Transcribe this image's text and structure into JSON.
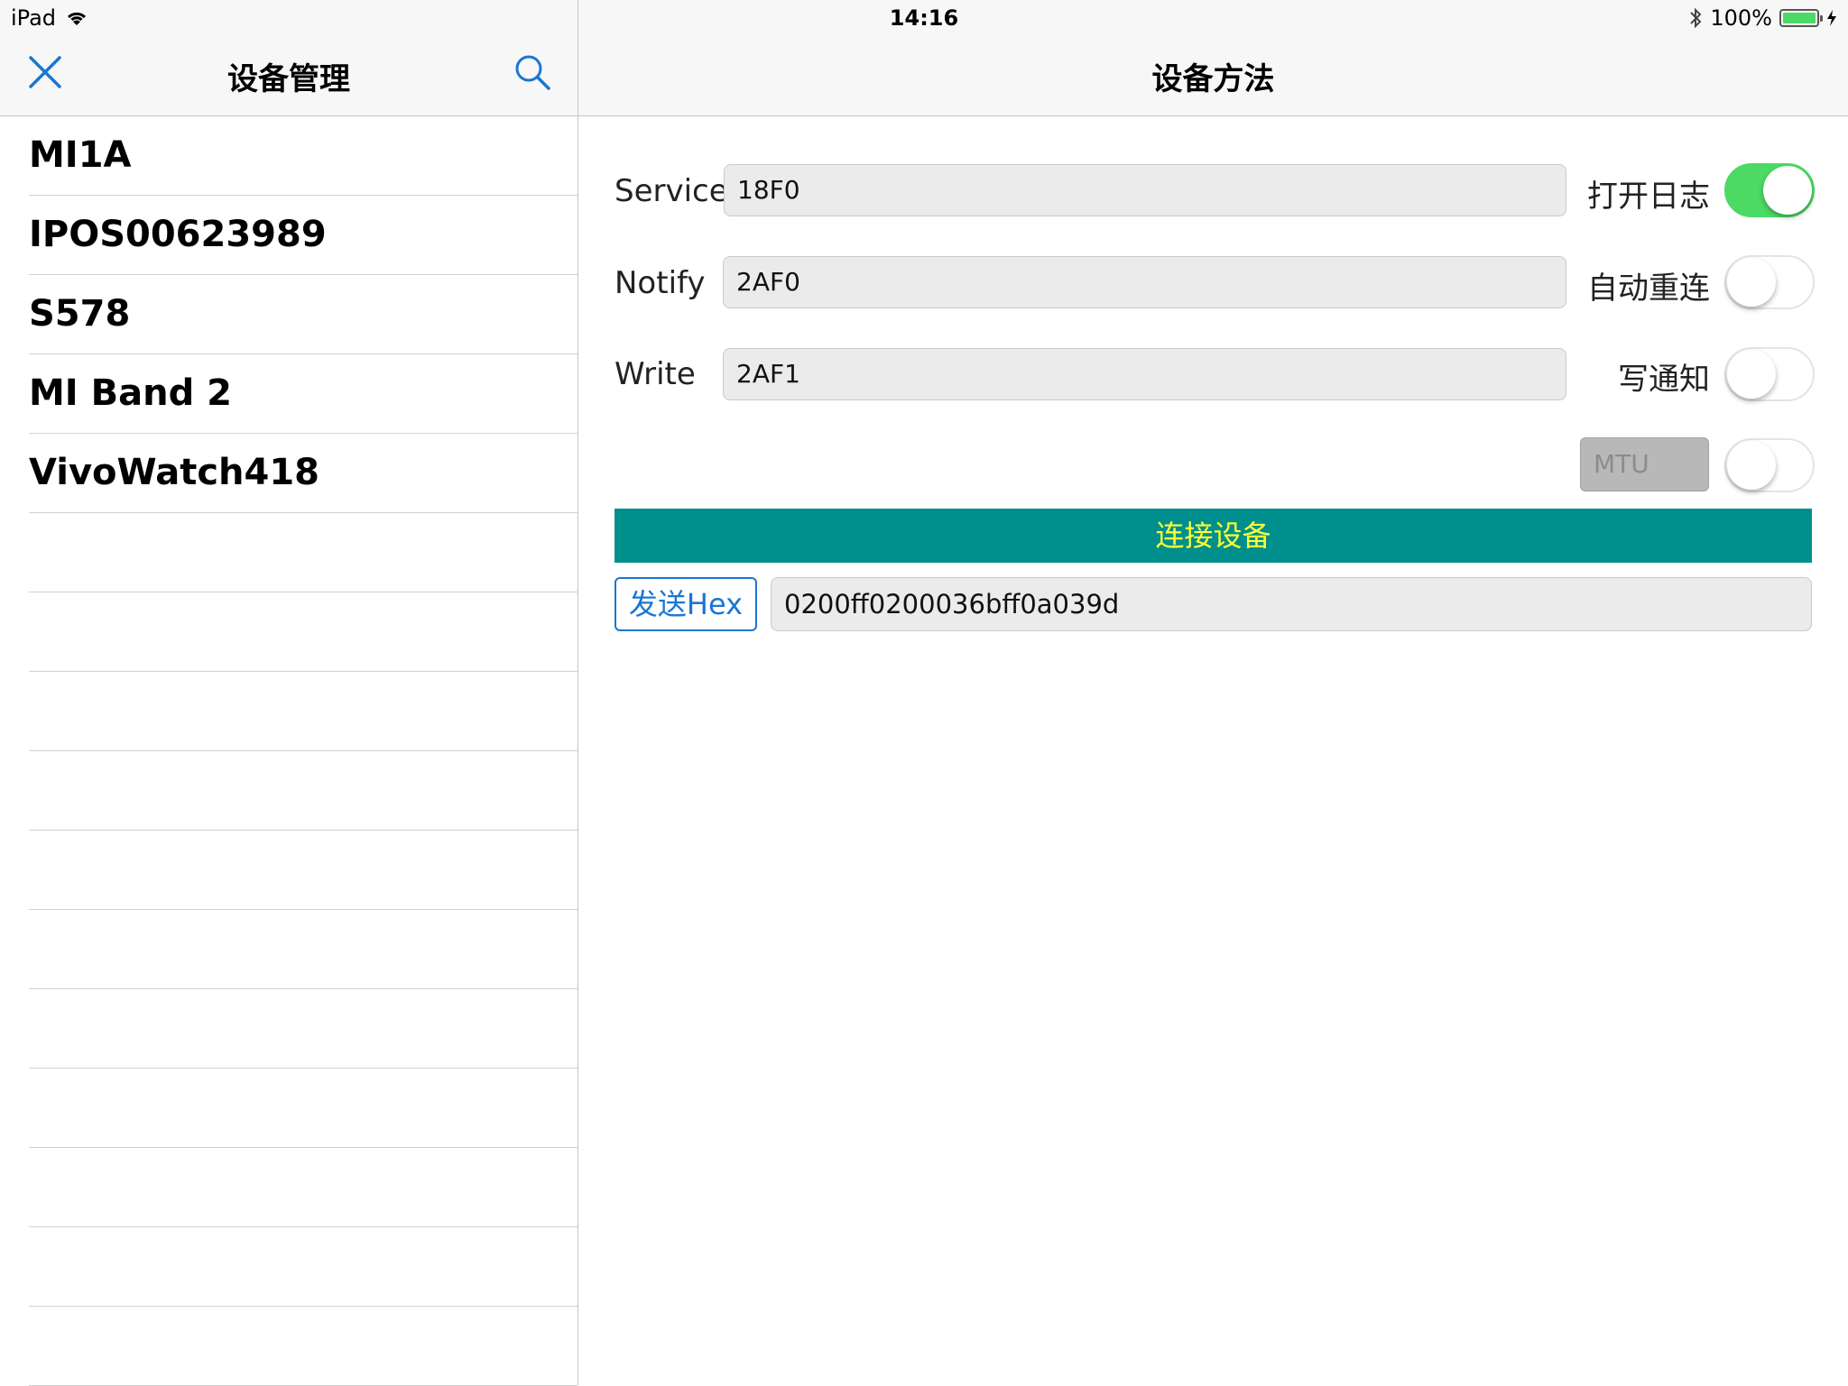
{
  "status_bar": {
    "device": "iPad",
    "time": "14:16",
    "battery": "100%",
    "battery_level": 1.0
  },
  "master": {
    "title": "设备管理",
    "close_icon": "close-icon",
    "search_icon": "search-icon",
    "devices": [
      "MI1A",
      "IPOS00623989",
      "S578",
      "MI Band 2",
      "VivoWatch418"
    ]
  },
  "detail": {
    "title": "设备方法",
    "service": {
      "label": "Service",
      "value": "18F0"
    },
    "notify": {
      "label": "Notify",
      "value": "2AF0"
    },
    "write": {
      "label": "Write",
      "value": "2AF1"
    },
    "switches": {
      "log": {
        "label": "打开日志",
        "on": true
      },
      "reconnect": {
        "label": "自动重连",
        "on": false
      },
      "write_notify": {
        "label": "写通知",
        "on": false
      },
      "mtu": {
        "label": "MTU",
        "on": false
      }
    },
    "connect_label": "连接设备",
    "send_hex_label": "发送Hex",
    "hex_value": "0200ff0200036bff0a039d"
  },
  "colors": {
    "accent_blue": "#1a76d2",
    "switch_on_green": "#4cd964",
    "connect_bg": "#008f8c",
    "connect_text": "#ffff33"
  }
}
